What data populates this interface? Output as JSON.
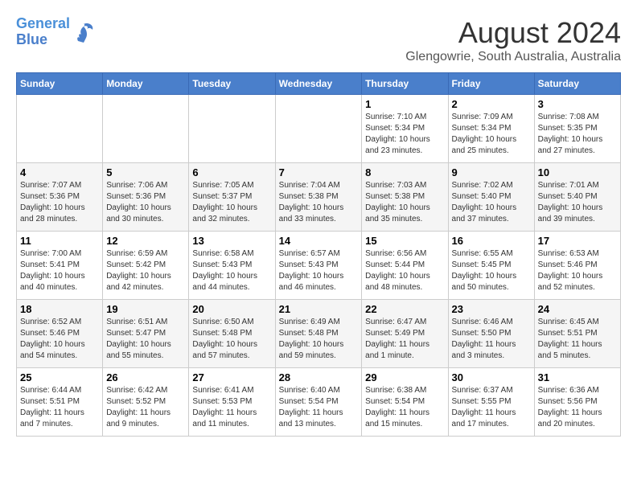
{
  "header": {
    "logo_line1": "General",
    "logo_line2": "Blue",
    "title": "August 2024",
    "subtitle": "Glengowrie, South Australia, Australia"
  },
  "days_of_week": [
    "Sunday",
    "Monday",
    "Tuesday",
    "Wednesday",
    "Thursday",
    "Friday",
    "Saturday"
  ],
  "weeks": [
    [
      {
        "num": "",
        "info": ""
      },
      {
        "num": "",
        "info": ""
      },
      {
        "num": "",
        "info": ""
      },
      {
        "num": "",
        "info": ""
      },
      {
        "num": "1",
        "info": "Sunrise: 7:10 AM\nSunset: 5:34 PM\nDaylight: 10 hours\nand 23 minutes."
      },
      {
        "num": "2",
        "info": "Sunrise: 7:09 AM\nSunset: 5:34 PM\nDaylight: 10 hours\nand 25 minutes."
      },
      {
        "num": "3",
        "info": "Sunrise: 7:08 AM\nSunset: 5:35 PM\nDaylight: 10 hours\nand 27 minutes."
      }
    ],
    [
      {
        "num": "4",
        "info": "Sunrise: 7:07 AM\nSunset: 5:36 PM\nDaylight: 10 hours\nand 28 minutes."
      },
      {
        "num": "5",
        "info": "Sunrise: 7:06 AM\nSunset: 5:36 PM\nDaylight: 10 hours\nand 30 minutes."
      },
      {
        "num": "6",
        "info": "Sunrise: 7:05 AM\nSunset: 5:37 PM\nDaylight: 10 hours\nand 32 minutes."
      },
      {
        "num": "7",
        "info": "Sunrise: 7:04 AM\nSunset: 5:38 PM\nDaylight: 10 hours\nand 33 minutes."
      },
      {
        "num": "8",
        "info": "Sunrise: 7:03 AM\nSunset: 5:38 PM\nDaylight: 10 hours\nand 35 minutes."
      },
      {
        "num": "9",
        "info": "Sunrise: 7:02 AM\nSunset: 5:40 PM\nDaylight: 10 hours\nand 37 minutes."
      },
      {
        "num": "10",
        "info": "Sunrise: 7:01 AM\nSunset: 5:40 PM\nDaylight: 10 hours\nand 39 minutes."
      }
    ],
    [
      {
        "num": "11",
        "info": "Sunrise: 7:00 AM\nSunset: 5:41 PM\nDaylight: 10 hours\nand 40 minutes."
      },
      {
        "num": "12",
        "info": "Sunrise: 6:59 AM\nSunset: 5:42 PM\nDaylight: 10 hours\nand 42 minutes."
      },
      {
        "num": "13",
        "info": "Sunrise: 6:58 AM\nSunset: 5:43 PM\nDaylight: 10 hours\nand 44 minutes."
      },
      {
        "num": "14",
        "info": "Sunrise: 6:57 AM\nSunset: 5:43 PM\nDaylight: 10 hours\nand 46 minutes."
      },
      {
        "num": "15",
        "info": "Sunrise: 6:56 AM\nSunset: 5:44 PM\nDaylight: 10 hours\nand 48 minutes."
      },
      {
        "num": "16",
        "info": "Sunrise: 6:55 AM\nSunset: 5:45 PM\nDaylight: 10 hours\nand 50 minutes."
      },
      {
        "num": "17",
        "info": "Sunrise: 6:53 AM\nSunset: 5:46 PM\nDaylight: 10 hours\nand 52 minutes."
      }
    ],
    [
      {
        "num": "18",
        "info": "Sunrise: 6:52 AM\nSunset: 5:46 PM\nDaylight: 10 hours\nand 54 minutes."
      },
      {
        "num": "19",
        "info": "Sunrise: 6:51 AM\nSunset: 5:47 PM\nDaylight: 10 hours\nand 55 minutes."
      },
      {
        "num": "20",
        "info": "Sunrise: 6:50 AM\nSunset: 5:48 PM\nDaylight: 10 hours\nand 57 minutes."
      },
      {
        "num": "21",
        "info": "Sunrise: 6:49 AM\nSunset: 5:48 PM\nDaylight: 10 hours\nand 59 minutes."
      },
      {
        "num": "22",
        "info": "Sunrise: 6:47 AM\nSunset: 5:49 PM\nDaylight: 11 hours\nand 1 minute."
      },
      {
        "num": "23",
        "info": "Sunrise: 6:46 AM\nSunset: 5:50 PM\nDaylight: 11 hours\nand 3 minutes."
      },
      {
        "num": "24",
        "info": "Sunrise: 6:45 AM\nSunset: 5:51 PM\nDaylight: 11 hours\nand 5 minutes."
      }
    ],
    [
      {
        "num": "25",
        "info": "Sunrise: 6:44 AM\nSunset: 5:51 PM\nDaylight: 11 hours\nand 7 minutes."
      },
      {
        "num": "26",
        "info": "Sunrise: 6:42 AM\nSunset: 5:52 PM\nDaylight: 11 hours\nand 9 minutes."
      },
      {
        "num": "27",
        "info": "Sunrise: 6:41 AM\nSunset: 5:53 PM\nDaylight: 11 hours\nand 11 minutes."
      },
      {
        "num": "28",
        "info": "Sunrise: 6:40 AM\nSunset: 5:54 PM\nDaylight: 11 hours\nand 13 minutes."
      },
      {
        "num": "29",
        "info": "Sunrise: 6:38 AM\nSunset: 5:54 PM\nDaylight: 11 hours\nand 15 minutes."
      },
      {
        "num": "30",
        "info": "Sunrise: 6:37 AM\nSunset: 5:55 PM\nDaylight: 11 hours\nand 17 minutes."
      },
      {
        "num": "31",
        "info": "Sunrise: 6:36 AM\nSunset: 5:56 PM\nDaylight: 11 hours\nand 20 minutes."
      }
    ]
  ]
}
